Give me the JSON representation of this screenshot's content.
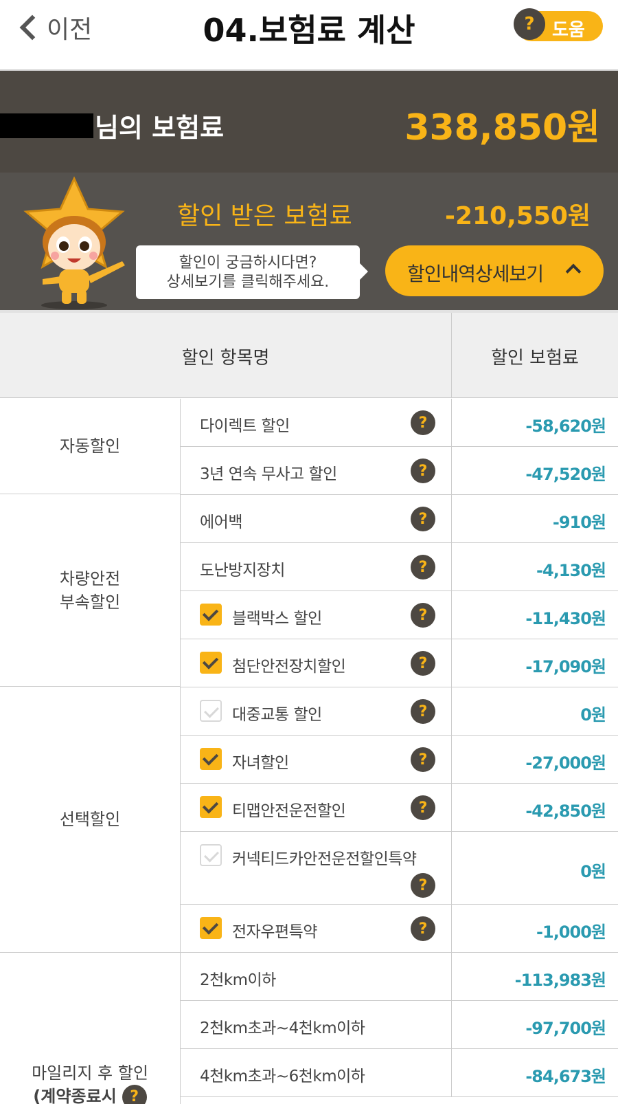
{
  "header": {
    "back_label": "이전",
    "title": "04.보험료 계산",
    "help_q": "?",
    "help_label": "도움"
  },
  "summary": {
    "name_suffix": "님의 보험료",
    "total_amount": "338,850원",
    "discount_label": "할인 받은 보험료",
    "discount_amount": "-210,550원",
    "bubble_line1": "할인이 궁금하시다면?",
    "bubble_line2": "상세보기를 클릭해주세요.",
    "detail_button": "할인내역상세보기"
  },
  "table": {
    "col_item": "할인 항목명",
    "col_amount": "할인 보험료",
    "groups": [
      {
        "label": "자동할인"
      },
      {
        "label_line1": "차량안전",
        "label_line2": "부속할인"
      },
      {
        "label": "선택할인"
      },
      {
        "label_line1": "마일리지 후 할인",
        "label_line2": "(계약종료시"
      }
    ],
    "rows": [
      {
        "name": "다이렉트 할인",
        "amount": "-58,620원",
        "checkbox": null,
        "help": true
      },
      {
        "name": "3년 연속 무사고 할인",
        "amount": "-47,520원",
        "checkbox": null,
        "help": true
      },
      {
        "name": "에어백",
        "amount": "-910원",
        "checkbox": null,
        "help": true
      },
      {
        "name": "도난방지장치",
        "amount": "-4,130원",
        "checkbox": null,
        "help": true
      },
      {
        "name": "블랙박스 할인",
        "amount": "-11,430원",
        "checkbox": true,
        "help": true
      },
      {
        "name": "첨단안전장치할인",
        "amount": "-17,090원",
        "checkbox": true,
        "help": true
      },
      {
        "name": "대중교통 할인",
        "amount": "0원",
        "checkbox": false,
        "help": true
      },
      {
        "name": "자녀할인",
        "amount": "-27,000원",
        "checkbox": true,
        "help": true
      },
      {
        "name": "티맵안전운전할인",
        "amount": "-42,850원",
        "checkbox": true,
        "help": true
      },
      {
        "name": "커넥티드카안전운전할인특약",
        "amount": "0원",
        "checkbox": false,
        "help": true
      },
      {
        "name": "전자우편특약",
        "amount": "-1,000원",
        "checkbox": true,
        "help": true
      },
      {
        "name": "2천km이하",
        "amount": "-113,983원",
        "checkbox": null,
        "help": false
      },
      {
        "name": "2천km초과~4천km이하",
        "amount": "-97,700원",
        "checkbox": null,
        "help": false
      },
      {
        "name": "4천km초과~6천km이하",
        "amount": "-84,673원",
        "checkbox": null,
        "help": false
      }
    ]
  },
  "colors": {
    "accent": "#f9b417",
    "dark_band": "#4d4842",
    "amount_teal": "#2a9ab0"
  },
  "icons": [
    "chevron-left-icon",
    "question-icon",
    "chevron-up-icon",
    "checkbox-icon",
    "star-mascot"
  ]
}
